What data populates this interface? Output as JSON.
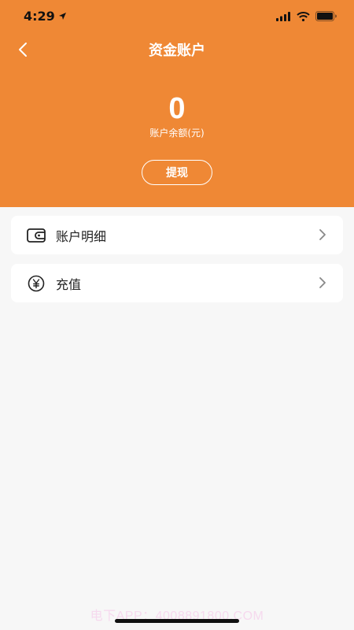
{
  "status_bar": {
    "time": "4:29"
  },
  "nav": {
    "title": "资金账户"
  },
  "account": {
    "balance": "0",
    "balance_label": "账户余额(元)",
    "withdraw_label": "提现"
  },
  "menu": {
    "items": [
      {
        "label": "账户明细",
        "icon": "wallet-icon"
      },
      {
        "label": "充值",
        "icon": "yuan-icon"
      }
    ]
  },
  "watermark": "电下APP：4008891800.COM",
  "colors": {
    "primary": "#ef8835",
    "background": "#f7f7f7",
    "card": "#ffffff"
  }
}
